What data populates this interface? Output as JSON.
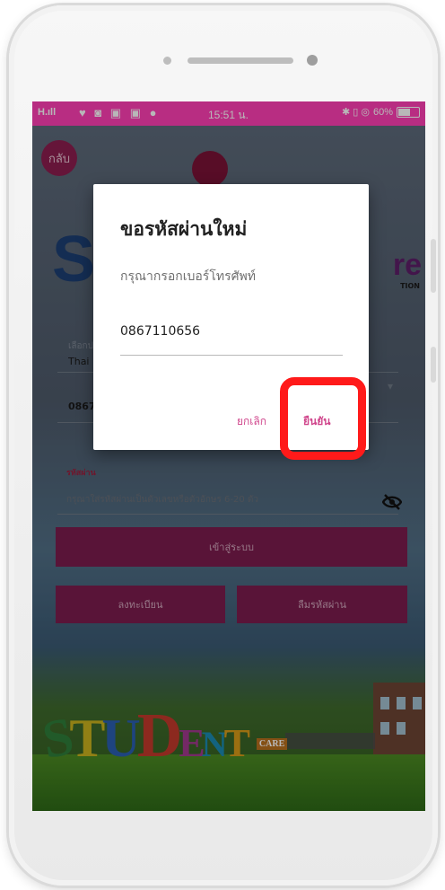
{
  "status_bar": {
    "signal": "H.ıll",
    "notification_icons": "♥ ◙ ▣ ▣ ●",
    "time": "15:51 น.",
    "right_icons": "✱ ▯ ◎",
    "battery": "60%"
  },
  "app": {
    "back_label": "กลับ",
    "logo_s": "S",
    "logo_re": "re",
    "logo_sub": "TION",
    "country_label": "เลือกประเทศ",
    "country_value": "Thai",
    "phone_value": "0867",
    "password_label": "รหัสผ่าน",
    "password_hint": "กรุณาใส่รหัสผ่านเป็นตัวเลขหรือตัวอักษร 6-20 ตัว",
    "login_button": "เข้าสู่ระบบ",
    "register_button": "ลงทะเบียน",
    "forgot_button": "ลืมรหัสผ่าน",
    "banner_text": "STUDENT",
    "banner_small": "CARE"
  },
  "dialog": {
    "title": "ขอรหัสผ่านใหม่",
    "message": "กรุณากรอกเบอร์โทรศัพท์",
    "phone_value": "0867110656",
    "cancel_label": "ยกเลิก",
    "confirm_label": "ยืนยัน"
  },
  "colors": {
    "status_bar": "#ff3fb5",
    "primary": "#7c1d4e",
    "dialog_action": "#d0468c",
    "highlight": "#ff1a1a"
  }
}
